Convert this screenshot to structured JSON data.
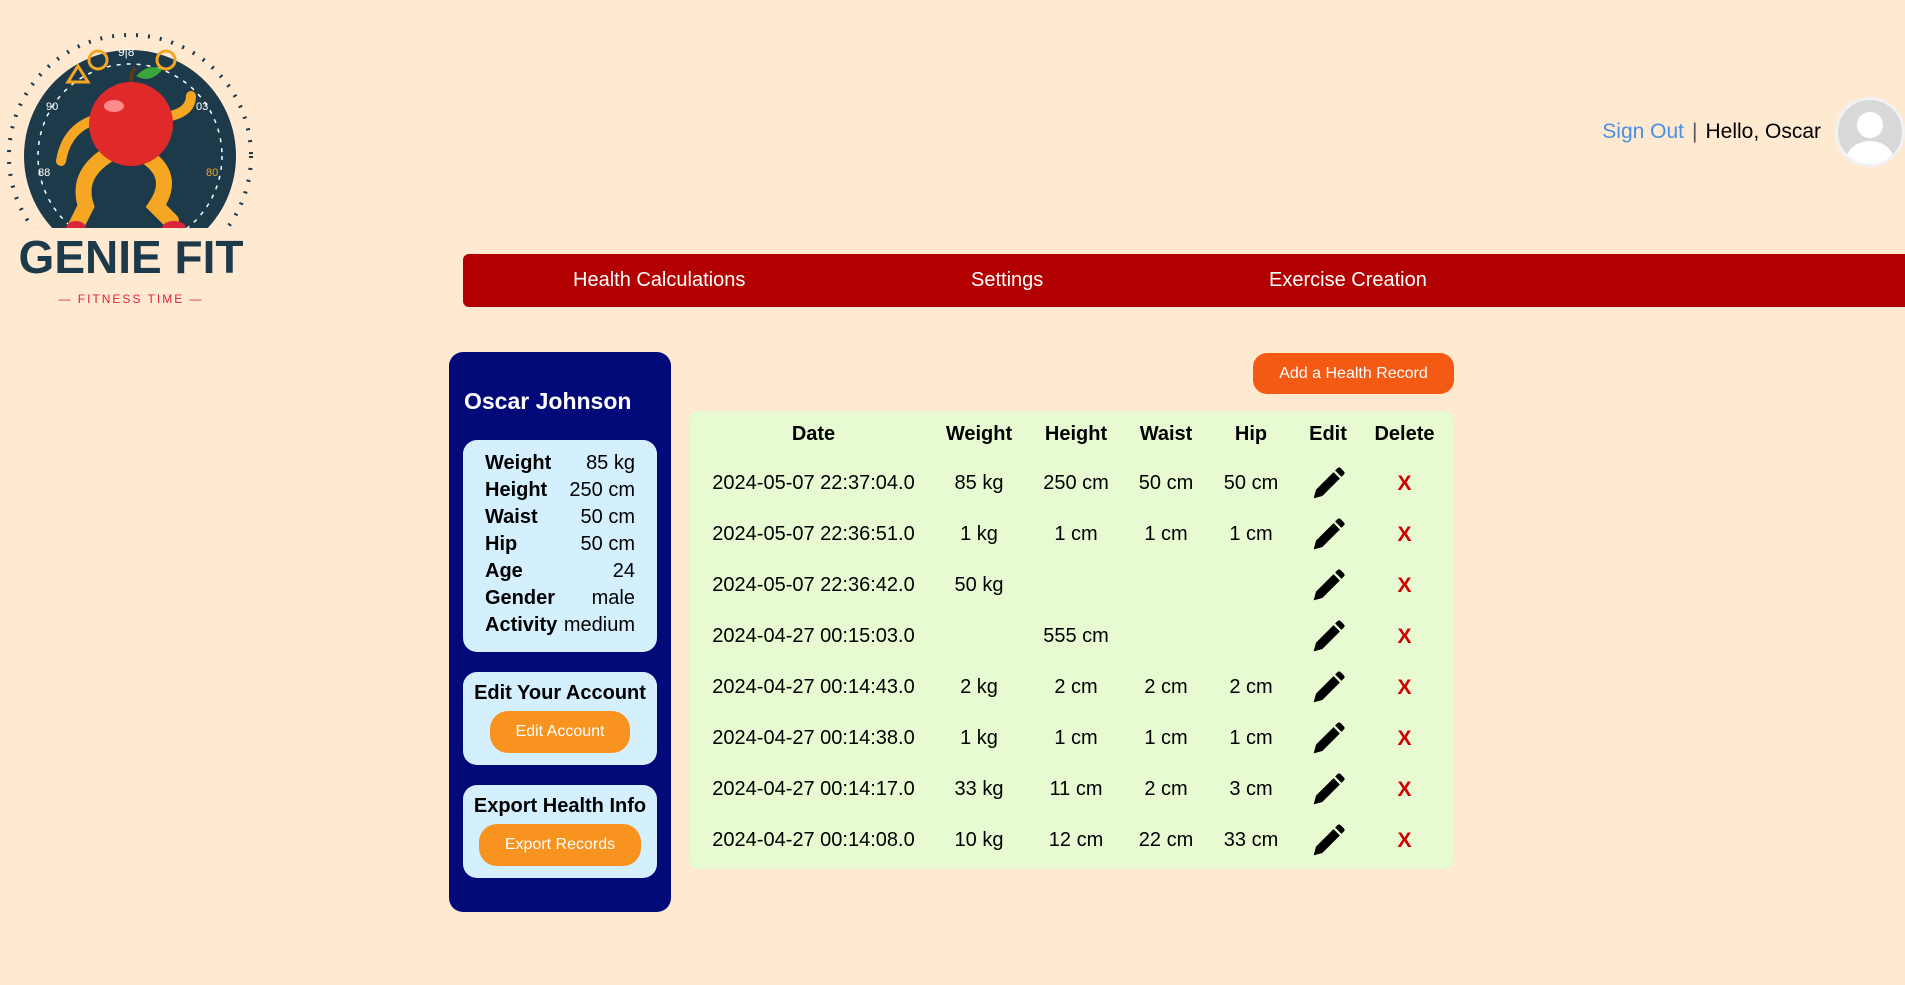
{
  "logo": {
    "brand": "GENIE FIT",
    "tagline": "FITNESS TIME"
  },
  "header": {
    "sign_out": "Sign Out",
    "separator": "|",
    "greeting": "Hello, Oscar"
  },
  "nav": [
    {
      "label": "Health Calculations"
    },
    {
      "label": "Settings"
    },
    {
      "label": "Exercise Creation"
    }
  ],
  "profile": {
    "name": "Oscar Johnson",
    "stats": [
      {
        "key": "Weight",
        "value": "85 kg"
      },
      {
        "key": "Height",
        "value": "250 cm"
      },
      {
        "key": "Waist",
        "value": "50 cm"
      },
      {
        "key": "Hip",
        "value": "50 cm"
      },
      {
        "key": "Age",
        "value": "24"
      },
      {
        "key": "Gender",
        "value": "male"
      },
      {
        "key": "Activity",
        "value": "medium"
      }
    ]
  },
  "edit_box": {
    "title": "Edit Your Account",
    "button": "Edit Account"
  },
  "export_box": {
    "title": "Export Health Info",
    "button": "Export Records"
  },
  "add_record": "Add a Health Record",
  "records": {
    "headers": [
      "Date",
      "Weight",
      "Height",
      "Waist",
      "Hip",
      "Edit",
      "Delete"
    ],
    "delete_label": "X",
    "rows": [
      {
        "date": "2024-05-07 22:37:04.0",
        "weight": "85 kg",
        "height": "250 cm",
        "waist": "50 cm",
        "hip": "50 cm"
      },
      {
        "date": "2024-05-07 22:36:51.0",
        "weight": "1 kg",
        "height": "1 cm",
        "waist": "1 cm",
        "hip": "1 cm"
      },
      {
        "date": "2024-05-07 22:36:42.0",
        "weight": "50 kg",
        "height": "",
        "waist": "",
        "hip": ""
      },
      {
        "date": "2024-04-27 00:15:03.0",
        "weight": "",
        "height": "555 cm",
        "waist": "",
        "hip": ""
      },
      {
        "date": "2024-04-27 00:14:43.0",
        "weight": "2 kg",
        "height": "2 cm",
        "waist": "2 cm",
        "hip": "2 cm"
      },
      {
        "date": "2024-04-27 00:14:38.0",
        "weight": "1 kg",
        "height": "1 cm",
        "waist": "1 cm",
        "hip": "1 cm"
      },
      {
        "date": "2024-04-27 00:14:17.0",
        "weight": "33 kg",
        "height": "11 cm",
        "waist": "2 cm",
        "hip": "3 cm"
      },
      {
        "date": "2024-04-27 00:14:08.0",
        "weight": "10 kg",
        "height": "12 cm",
        "waist": "22 cm",
        "hip": "33 cm"
      }
    ]
  },
  "colors": {
    "background": "#ffe9d1",
    "nav": "#b30000",
    "sidebar": "#020a7a",
    "table_bg": "#e8fad2",
    "accent_orange": "#f7931e",
    "add_button": "#f55a14",
    "delete": "#d00000"
  }
}
